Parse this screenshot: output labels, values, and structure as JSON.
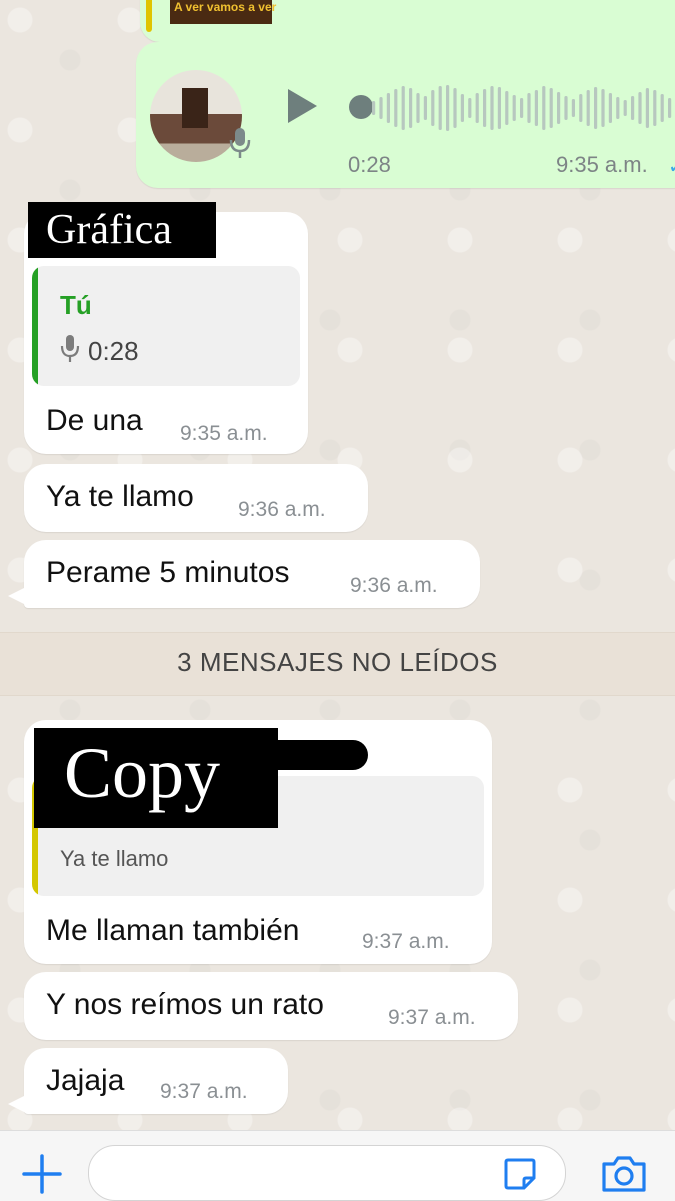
{
  "top_card": {
    "caption": "A ver vamos a ver"
  },
  "voice_message": {
    "duration": "0:28",
    "time": "9:35 a.m."
  },
  "group1": {
    "sender_label": "Gráfica",
    "quote": {
      "author": "Tú",
      "duration": "0:28"
    },
    "messages": [
      {
        "text": "De una",
        "time": "9:35 a.m."
      },
      {
        "text": "Ya te llamo",
        "time": "9:36 a.m."
      },
      {
        "text": "Perame 5 minutos",
        "time": "9:36 a.m."
      }
    ]
  },
  "unread_banner": "3 MENSAJES NO LEÍDOS",
  "group2": {
    "sender_label": "Copy",
    "quote": {
      "text": "Ya te llamo"
    },
    "messages": [
      {
        "text": "Me llaman también",
        "time": "9:37 a.m."
      },
      {
        "text": "Y nos reímos un rato",
        "time": "9:37 a.m."
      },
      {
        "text": "Jajaja",
        "time": "9:37 a.m."
      }
    ]
  },
  "composer": {
    "placeholder": ""
  },
  "colors": {
    "accent_green": "#25a025",
    "ios_blue": "#1f7ef0",
    "quote_yellow": "#d4c700"
  },
  "icons": [
    "play-icon",
    "mic-icon",
    "plus-icon",
    "sticker-icon",
    "camera-icon"
  ]
}
